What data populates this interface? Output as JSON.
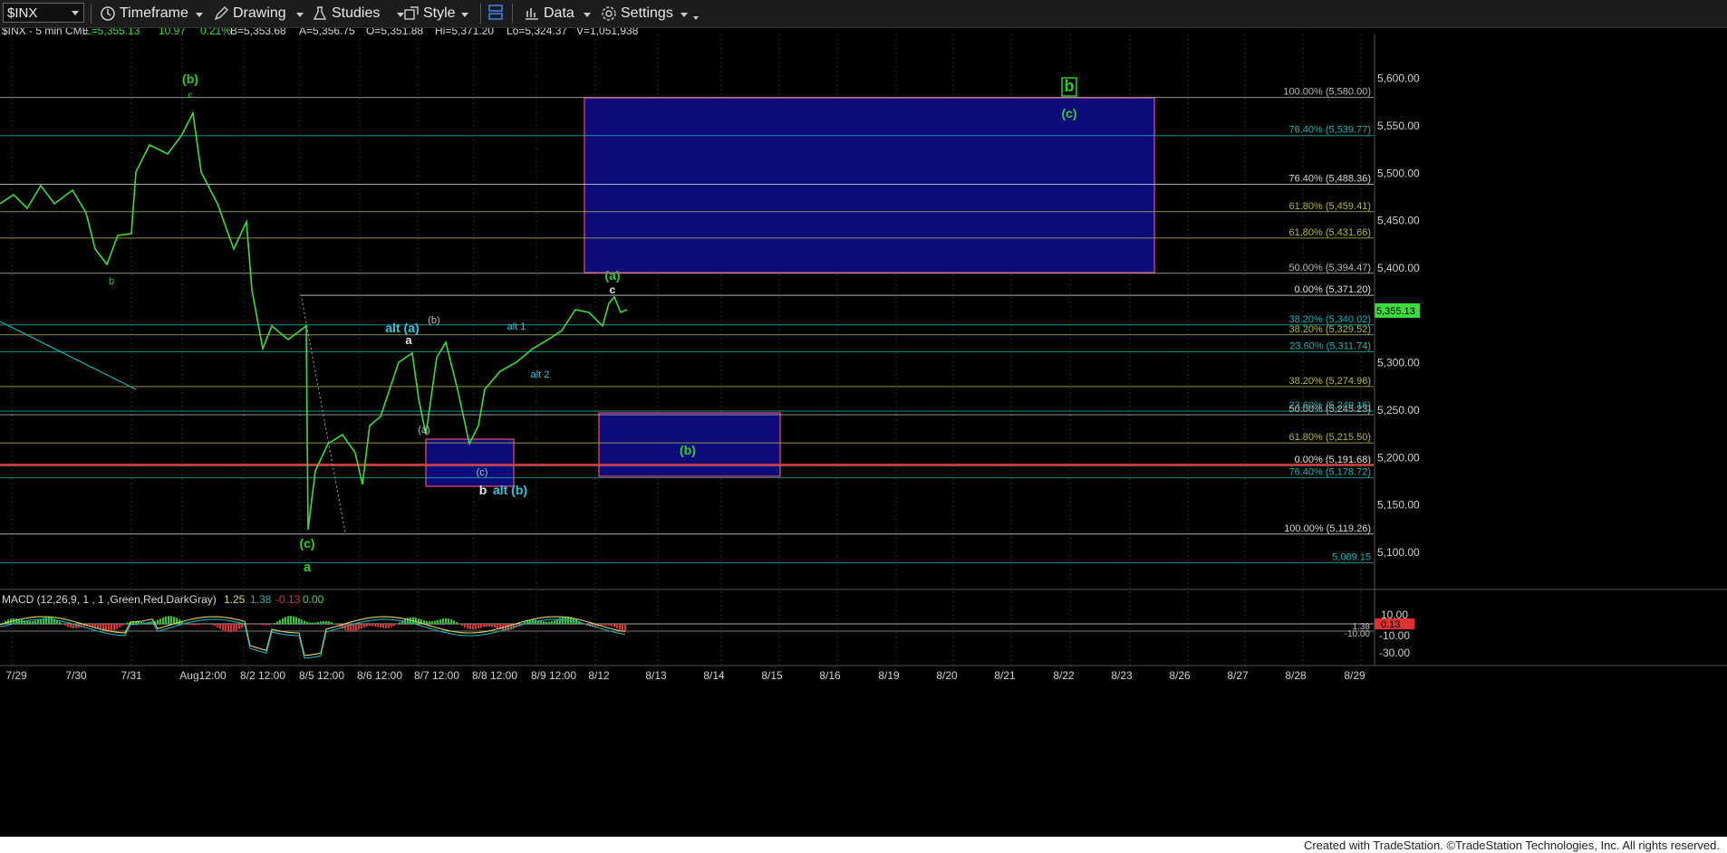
{
  "toolbar": {
    "symbol": "$INX",
    "timeframe": "Timeframe",
    "drawing": "Drawing",
    "studies": "Studies",
    "style": "Style",
    "data": "Data",
    "settings": "Settings"
  },
  "header": {
    "symbol_info": "$INX - 5 min  CME",
    "last": "L=5,355.13",
    "change": "10.97",
    "pct": "0.21%",
    "bid": "B=5,353.68",
    "ask": "A=5,356.75",
    "open": "O=5,351.88",
    "high": "Hi=5,371.20",
    "low": "Lo=5,324.37",
    "volume": "V=1,051,938"
  },
  "price_axis": {
    "ticks": [
      {
        "value": 5600,
        "label": "5,600.00"
      },
      {
        "value": 5550,
        "label": "5,550.00"
      },
      {
        "value": 5500,
        "label": "5,500.00"
      },
      {
        "value": 5450,
        "label": "5,450.00"
      },
      {
        "value": 5400,
        "label": "5,400.00"
      },
      {
        "value": 5300,
        "label": "5,300.00"
      },
      {
        "value": 5250,
        "label": "5,250.00"
      },
      {
        "value": 5200,
        "label": "5,200.00"
      },
      {
        "value": 5150,
        "label": "5,150.00"
      },
      {
        "value": 5100,
        "label": "5,100.00"
      }
    ],
    "last_price": "5,355.13"
  },
  "date_axis": [
    "7/29",
    "7/30",
    "7/31",
    "Aug12:00",
    "8/2 12:00",
    "8/5 12:00",
    "8/6 12:00",
    "8/7 12:00",
    "8/8 12:00",
    "8/9 12:00",
    "8/12",
    "8/13",
    "8/14",
    "8/15",
    "8/16",
    "8/19",
    "8/20",
    "8/21",
    "8/22",
    "8/23",
    "8/26",
    "8/27",
    "8/28",
    "8/29"
  ],
  "fib_levels": [
    {
      "price": 5580.0,
      "label": "100.00% (5,580.00)",
      "color": "#b8b8b8"
    },
    {
      "price": 5539.77,
      "label": "76.40% (5,539.77)",
      "color": "#19b3b3"
    },
    {
      "price": 5488.36,
      "label": "76.40% (5,488.36)",
      "color": "#d8d8d8"
    },
    {
      "price": 5459.41,
      "label": "61.80% (5,459.41)",
      "color": "#b5b541"
    },
    {
      "price": 5431.66,
      "label": "61.80% (5,431.66)",
      "color": "#b5b541"
    },
    {
      "price": 5394.47,
      "label": "50.00% (5,394.47)",
      "color": "#b8b8b8"
    },
    {
      "price": 5371.2,
      "label": "0.00% (5,371.20)",
      "color": "#e0e0e0"
    },
    {
      "price": 5340.02,
      "label": "38.20% (5,340.02)",
      "color": "#19b3b3"
    },
    {
      "price": 5329.52,
      "label": "38.20% (5,329.52)",
      "color": "#b5b541"
    },
    {
      "price": 5311.74,
      "label": "23.60% (5,311.74)",
      "color": "#19b3b3"
    },
    {
      "price": 5274.96,
      "label": "38.20% (5,274.96)",
      "color": "#b5b541"
    },
    {
      "price": 5249.0,
      "label": "23.60% (5,249.16)",
      "color": "#19b3b3"
    },
    {
      "price": 5245.23,
      "label": "50.00% (5,245.23)",
      "color": "#b8b8b8"
    },
    {
      "price": 5215.5,
      "label": "61.80% (5,215.50)",
      "color": "#b5b541"
    },
    {
      "price": 5191.68,
      "label": "0.00% (5,191.68)",
      "color": "#e0e0e0"
    },
    {
      "price": 5178.72,
      "label": "76.40% (5,178.72)",
      "color": "#19b3b3"
    },
    {
      "price": 5119.26,
      "label": "100.00% (5,119.26)",
      "color": "#d8d8d8"
    },
    {
      "price": 5089.15,
      "label": "5,089.15",
      "color": "#19b3b3"
    }
  ],
  "wave_labels": [
    {
      "text": "(b)",
      "color": "#2ecc2e"
    },
    {
      "text": "c",
      "color": "#2ecc2e"
    },
    {
      "text": "b",
      "color": "#2ecc2e"
    },
    {
      "text": "(c)",
      "color": "#2ecc2e"
    },
    {
      "text": "a",
      "color": "#2ecc2e"
    },
    {
      "text": "alt (a)",
      "color": "#33c6e0"
    },
    {
      "text": "a",
      "color": "#e8e8e8"
    },
    {
      "text": "(b)",
      "color": "#c0c0c0"
    },
    {
      "text": "(a)",
      "color": "#c0c0c0"
    },
    {
      "text": "(c)",
      "color": "#c0c0c0"
    },
    {
      "text": "b",
      "color": "#e8e8e8"
    },
    {
      "text": "alt (b)",
      "color": "#33c6e0"
    },
    {
      "text": "alt 1",
      "color": "#33c6e0"
    },
    {
      "text": "alt 2",
      "color": "#33c6e0"
    },
    {
      "text": "(a)",
      "color": "#2ecc2e"
    },
    {
      "text": "c",
      "color": "#e8e8e8"
    },
    {
      "text": "(b)",
      "color": "#2ecc2e"
    },
    {
      "text": "b",
      "color": "#2ecc2e"
    },
    {
      "text": "(c)",
      "color": "#2ecc2e"
    }
  ],
  "macd": {
    "title": "MACD (12,26,9, 1 , 1 ,Green,Red,DarkGray)",
    "v1": "1.25",
    "v2": "1.38",
    "v3": "-0.13",
    "v4": "0.00",
    "axis": [
      "10.00",
      "-10.00",
      "-30.00"
    ],
    "last_label": "0.13",
    "small_labels": [
      "1.38",
      "-10.00"
    ]
  },
  "colors": {
    "price_line": "#3cdc3c",
    "target_box_fill": "#0b0b7a",
    "target_box_border": "#c23a6c",
    "red_line": "#e03030"
  },
  "footer": "Created with TradeStation. ©TradeStation Technologies, Inc. All rights reserved."
}
